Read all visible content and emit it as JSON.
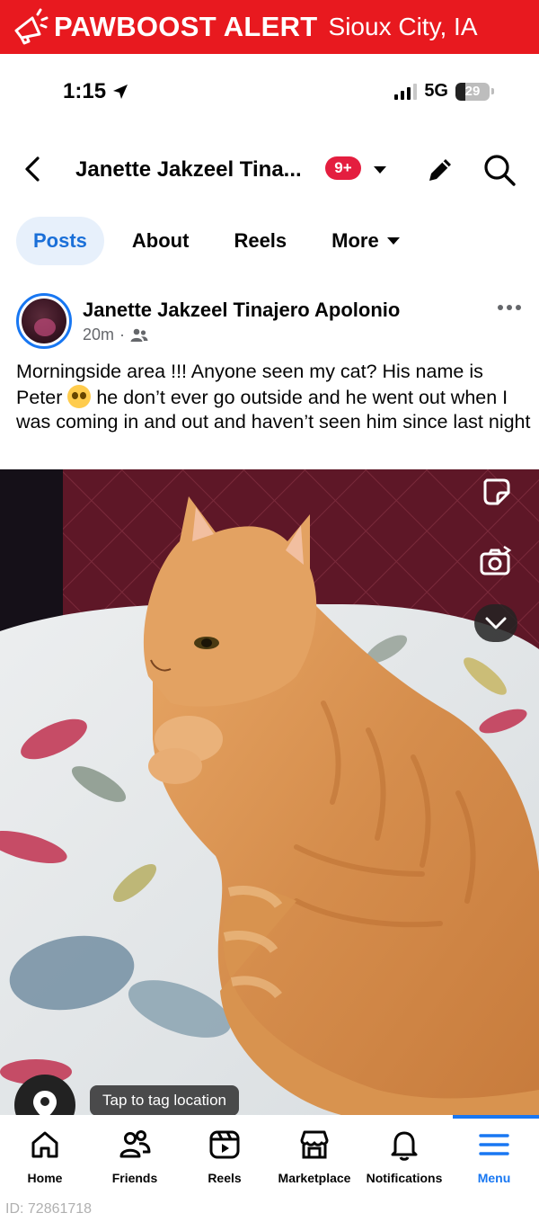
{
  "alert": {
    "brand": "PAWBOOST ALERT",
    "city": "Sioux City, IA",
    "icon": "megaphone-icon",
    "color": "#e8191f"
  },
  "status_bar": {
    "time": "1:15",
    "network": "5G",
    "battery": "29",
    "battery_level": 0.29
  },
  "header": {
    "page_name": "Janette Jakzeel Tina...",
    "notification_badge": "9+",
    "icons": [
      "back-arrow-icon",
      "caret-down-icon",
      "pencil-icon",
      "search-icon"
    ]
  },
  "tabs": [
    {
      "label": "Posts",
      "active": true
    },
    {
      "label": "About",
      "active": false
    },
    {
      "label": "Reels",
      "active": false
    },
    {
      "label": "More",
      "active": false
    }
  ],
  "post": {
    "author": "Janette Jakzeel Tinajero Apolonio",
    "time": "20m",
    "audience_icon": "friends-icon",
    "text_before_emoji": "Morningside area !!! Anyone seen my cat? His name is Peter ",
    "emoji": "pleading-face-emoji",
    "text_after_emoji": " he don’t ever go outside and he went out when I was coming in and out and haven’t seen him since last night",
    "tag_location_label": "Tap to tag location"
  },
  "bottom_nav": [
    {
      "label": "Home",
      "icon": "home-icon",
      "active": false
    },
    {
      "label": "Friends",
      "icon": "friends-icon",
      "active": false
    },
    {
      "label": "Reels",
      "icon": "reels-icon",
      "active": false
    },
    {
      "label": "Marketplace",
      "icon": "marketplace-icon",
      "active": false
    },
    {
      "label": "Notifications",
      "icon": "bell-icon",
      "active": false
    },
    {
      "label": "Menu",
      "icon": "menu-icon",
      "active": true
    }
  ],
  "image_id": "ID: 72861718",
  "colors": {
    "accent": "#1877f2",
    "badge": "#e41e3f",
    "active_tab_bg": "#e7f0fb"
  }
}
